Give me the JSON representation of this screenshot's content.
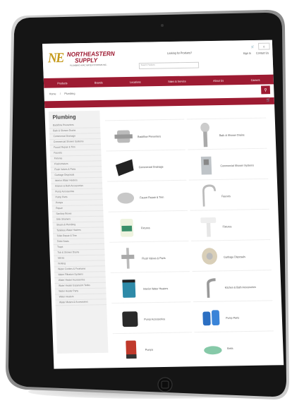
{
  "brand": {
    "mark": "NE",
    "name_line1": "NORTHEASTERN",
    "name_line2": "SUPPLY",
    "tagline": "PLUMBING HVAC WATER SYSTEMS INC."
  },
  "header": {
    "contact_link": "Looking for Products?",
    "user_links": [
      "Sign In",
      "Contact Us"
    ],
    "search_placeholder": "Search Products",
    "cart_label": "0"
  },
  "nav": {
    "items": [
      "Products",
      "Brands",
      "Locations",
      "Sales & Service",
      "About Us",
      "Careers"
    ]
  },
  "breadcrumb": [
    "Home",
    "Plumbing"
  ],
  "sidebar": {
    "title": "Plumbing",
    "items": [
      "Backflow Preventers",
      "Bath & Shower Drains",
      "Commercial Drainage",
      "Commercial Shower Systems",
      "Faucet Repair & Trim",
      "Faucets",
      "Fixtures",
      "Flushometers",
      "Flush Valves & Parts",
      "Garbage Disposals",
      "Interior Water Heaters",
      "Kitchen & Bath Accessories",
      "Pump Accessories",
      "Pump Parts",
      "Pumps",
      "Repair",
      "Sanitary Boxes",
      "Sink Strainers",
      "Steam & Plumbing",
      "Tankless Water Heaters",
      "Toilet Repair & Trim",
      "Toilet Seats",
      "Traps",
      "Tub & Shower Drains",
      "Valves",
      "Venting",
      "Water Coolers & Fountains",
      "Water Filtration Systems",
      "Water Heater Accessories",
      "Water Heater Expansion Tanks",
      "Water Heater Parts",
      "Water Heaters",
      "Water Meters & Accessories"
    ]
  },
  "products": [
    {
      "label": "Backflow Preventers",
      "icon": "backflow-preventer-icon"
    },
    {
      "label": "Bath & Shower Drains",
      "icon": "drain-icon"
    },
    {
      "label": "Commercial Drainage",
      "icon": "commercial-drain-icon"
    },
    {
      "label": "Commercial Shower Systems",
      "icon": "shower-system-icon"
    },
    {
      "label": "Faucet Repair & Trim",
      "icon": "faucet-repair-icon"
    },
    {
      "label": "Faucets",
      "icon": "faucet-icon"
    },
    {
      "label": "Fixtures",
      "icon": "fixture-jar-icon"
    },
    {
      "label": "Fixtures",
      "icon": "pedestal-sink-icon"
    },
    {
      "label": "Flush Valves & Parts",
      "icon": "flush-valve-icon"
    },
    {
      "label": "Garbage Disposals",
      "icon": "disposal-icon"
    },
    {
      "label": "Interior Water Heaters",
      "icon": "blue-tank-icon"
    },
    {
      "label": "Kitchen & Bath Accessories",
      "icon": "sensor-faucet-icon"
    },
    {
      "label": "Pump Accessories",
      "icon": "pump-accessory-icon"
    },
    {
      "label": "Pump Parts",
      "icon": "blue-pump-icon"
    },
    {
      "label": "Pumps",
      "icon": "red-pump-icon"
    },
    {
      "label": "Sinks",
      "icon": "green-sink-icon"
    }
  ],
  "colors": {
    "brand_red": "#9d1b32",
    "brand_gold": "#c59a1c",
    "tablet_body": "#1a1a1a"
  }
}
